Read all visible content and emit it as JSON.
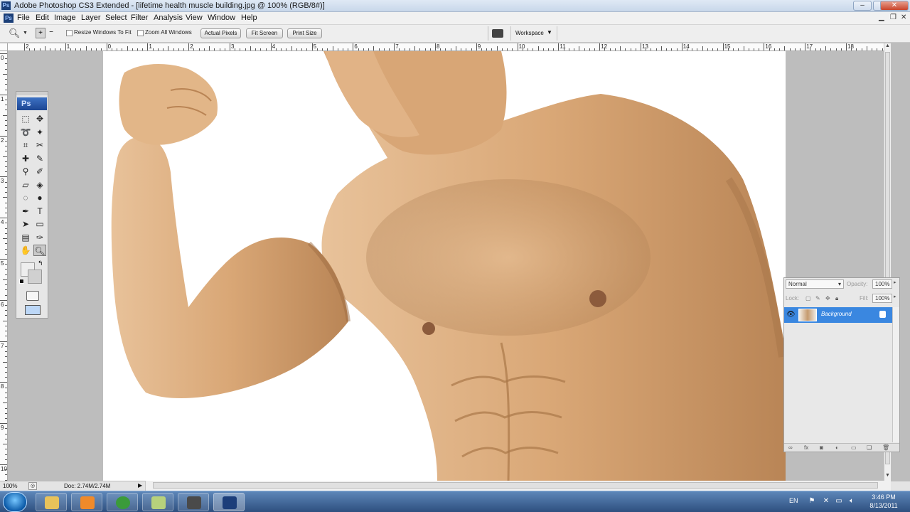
{
  "window": {
    "title": "Adobe Photoshop CS3 Extended - [lifetime health muscle building.jpg @ 100% (RGB/8#)]",
    "app_badge": "Ps"
  },
  "menu": [
    "File",
    "Edit",
    "Image",
    "Layer",
    "Select",
    "Filter",
    "Analysis",
    "View",
    "Window",
    "Help"
  ],
  "options_bar": {
    "resize_windows_label": "Resize Windows To Fit",
    "zoom_all_label": "Zoom All Windows",
    "actual_pixels": "Actual Pixels",
    "fit_screen": "Fit Screen",
    "print_size": "Print Size",
    "workspace": "Workspace"
  },
  "rulers": {
    "horizontal": [
      "2",
      "1",
      "0",
      "1",
      "2",
      "3",
      "4",
      "5",
      "6",
      "7",
      "8",
      "9",
      "10",
      "11",
      "12",
      "13",
      "14",
      "15",
      "16",
      "17",
      "18"
    ],
    "vertical": [
      "0",
      "1",
      "2",
      "3",
      "4",
      "5",
      "6",
      "7",
      "8",
      "9",
      "10"
    ]
  },
  "toolbox": {
    "badge": "Ps",
    "tools": [
      [
        "marquee-icon",
        "move-icon"
      ],
      [
        "lasso-icon",
        "magic-wand-icon"
      ],
      [
        "crop-icon",
        "slice-icon"
      ],
      [
        "healing-brush-icon",
        "brush-icon"
      ],
      [
        "clone-stamp-icon",
        "history-brush-icon"
      ],
      [
        "eraser-icon",
        "paint-bucket-icon"
      ],
      [
        "blur-icon",
        "dodge-icon"
      ],
      [
        "pen-icon",
        "type-icon"
      ],
      [
        "path-selection-icon",
        "rectangle-shape-icon"
      ],
      [
        "notes-icon",
        "eyedropper-icon"
      ],
      [
        "hand-icon",
        "zoom-icon"
      ]
    ]
  },
  "layers_panel": {
    "blend_mode": "Normal",
    "opacity_label": "Opacity:",
    "opacity_value": "100%",
    "lock_label": "Lock:",
    "fill_label": "Fill:",
    "fill_value": "100%",
    "layer_name": "Background"
  },
  "status": {
    "zoom": "100%",
    "doc_info": "Doc: 2.74M/2.74M"
  },
  "taskbar": {
    "language": "EN",
    "time": "3:46 PM",
    "date": "8/13/2011",
    "apps": [
      {
        "name": "windows-explorer",
        "color": "#e8c25a"
      },
      {
        "name": "media-player",
        "color": "#f08a2a"
      },
      {
        "name": "chrome",
        "color": "#3b9b3b"
      },
      {
        "name": "notes-app",
        "color": "#b7d17c"
      },
      {
        "name": "camera-app",
        "color": "#4a4a4a"
      },
      {
        "name": "photoshop",
        "color": "#1c3e7a"
      }
    ]
  },
  "colors": {
    "title_bar": "#c8d7ea",
    "selection_blue": "#3a87e0",
    "canvas_gray": "#bdbdbd",
    "skin": "#d8a979"
  }
}
